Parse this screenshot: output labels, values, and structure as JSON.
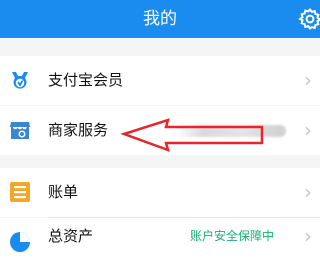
{
  "header": {
    "title": "我的",
    "settings_icon": "gear-icon",
    "background": "#1a8cf0"
  },
  "menu": [
    {
      "label": "支付宝会员",
      "icon": "member-badge-icon",
      "color": "#1a8cf0"
    },
    {
      "label": "商家服务",
      "icon": "store-icon",
      "color": "#3a86d6"
    },
    {
      "label": "账单",
      "icon": "bill-icon",
      "color": "#f5a623"
    },
    {
      "label": "总资产",
      "icon": "assets-icon",
      "color": "#1a8cf0",
      "extra": "账户安全保障中"
    }
  ],
  "annotation": {
    "type": "red-arrow",
    "color": "#e8252a",
    "points_to": "商家服务"
  }
}
